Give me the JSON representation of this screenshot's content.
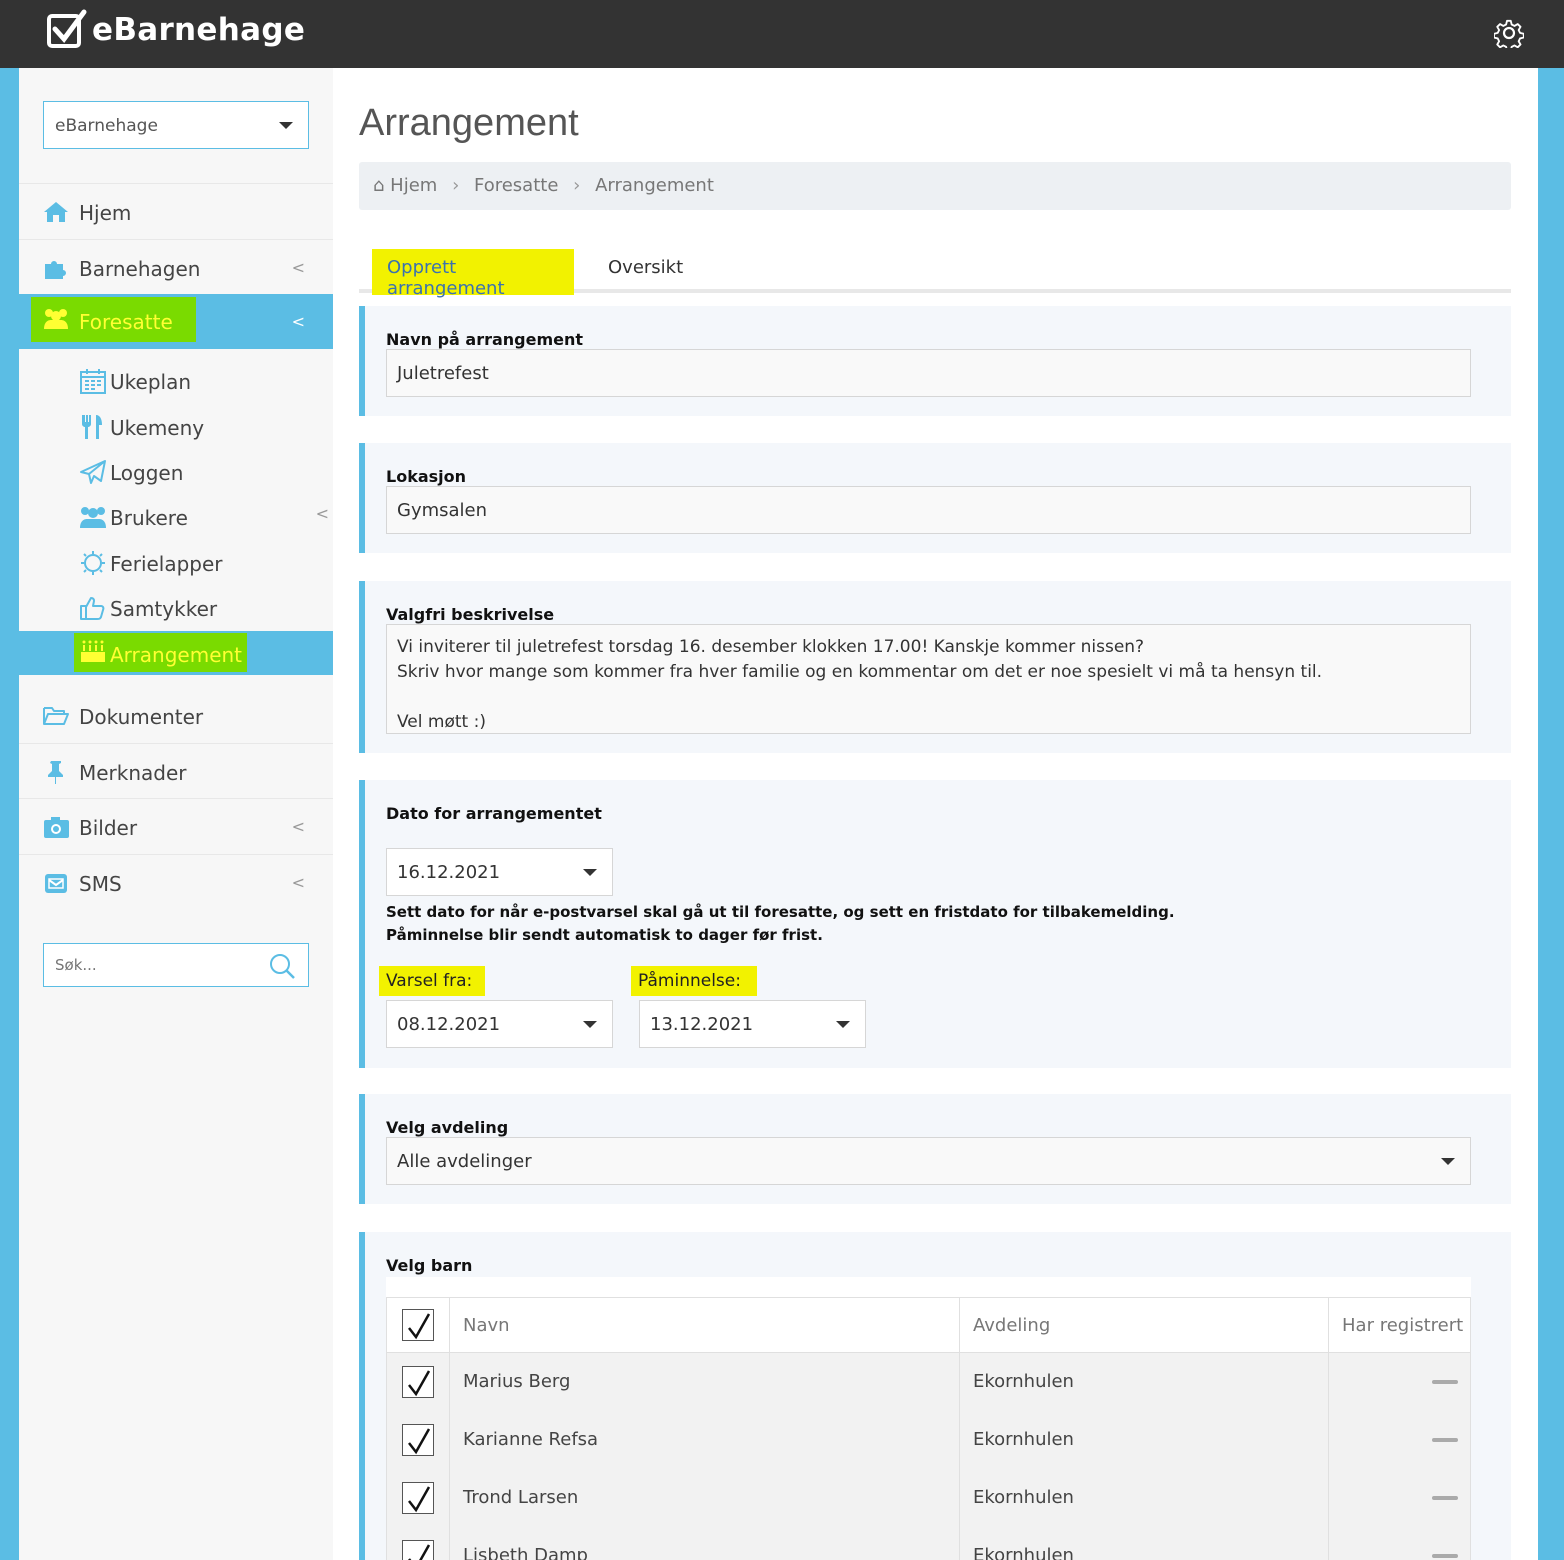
{
  "app": {
    "name": "eBarnehage"
  },
  "sidebar": {
    "org_select": "eBarnehage",
    "items": [
      {
        "label": "Hjem"
      },
      {
        "label": "Barnehagen"
      },
      {
        "label": "Foresatte"
      },
      {
        "label": "Dokumenter"
      },
      {
        "label": "Merknader"
      },
      {
        "label": "Bilder"
      },
      {
        "label": "SMS"
      }
    ],
    "sub_items": [
      {
        "label": "Ukeplan"
      },
      {
        "label": "Ukemeny"
      },
      {
        "label": "Loggen"
      },
      {
        "label": "Brukere"
      },
      {
        "label": "Ferielapper"
      },
      {
        "label": "Samtykker"
      },
      {
        "label": "Arrangement"
      }
    ],
    "search_placeholder": "Søk..."
  },
  "main": {
    "title": "Arrangement",
    "breadcrumb": [
      "Hjem",
      "Foresatte",
      "Arrangement"
    ],
    "tabs": [
      {
        "label": "Opprett arrangement"
      },
      {
        "label": "Oversikt"
      }
    ],
    "form": {
      "name_label": "Navn på arrangement",
      "name_value": "Juletrefest",
      "location_label": "Lokasjon",
      "location_value": "Gymsalen",
      "description_label": "Valgfri beskrivelse",
      "description_lines": [
        "Vi inviterer til juletrefest torsdag 16. desember klokken 17.00! Kanskje kommer nissen?",
        "Skriv hvor mange som kommer fra hver familie og en kommentar om det er noe spesielt vi må ta hensyn til.",
        "",
        "Vel møtt :)"
      ],
      "date_label": "Dato for arrangementet",
      "date_value": "16.12.2021",
      "info_line1": "Sett dato for når e-postvarsel skal gå ut til foresatte, og sett en fristdato for tilbakemelding.",
      "info_line2": "Påminnelse blir sendt automatisk to dager før frist.",
      "notify_label": "Varsel fra:",
      "notify_value": "08.12.2021",
      "reminder_label": "Påminnelse:",
      "reminder_value": "13.12.2021",
      "department_label": "Velg avdeling",
      "department_value": "Alle avdelinger",
      "children_label": "Velg barn"
    },
    "table": {
      "headers": [
        "Navn",
        "Avdeling",
        "Har registrert"
      ],
      "rows": [
        {
          "name": "Marius Berg",
          "department": "Ekornhulen"
        },
        {
          "name": "Karianne Refsa",
          "department": "Ekornhulen"
        },
        {
          "name": "Trond Larsen",
          "department": "Ekornhulen"
        },
        {
          "name": "Lisbeth Damp",
          "department": "Ekornhulen"
        }
      ]
    }
  },
  "colors": {
    "topbar": "#333333",
    "accent": "#5bbde4",
    "highlight_green": "#7adb00",
    "highlight_yellow": "#f2f200"
  }
}
